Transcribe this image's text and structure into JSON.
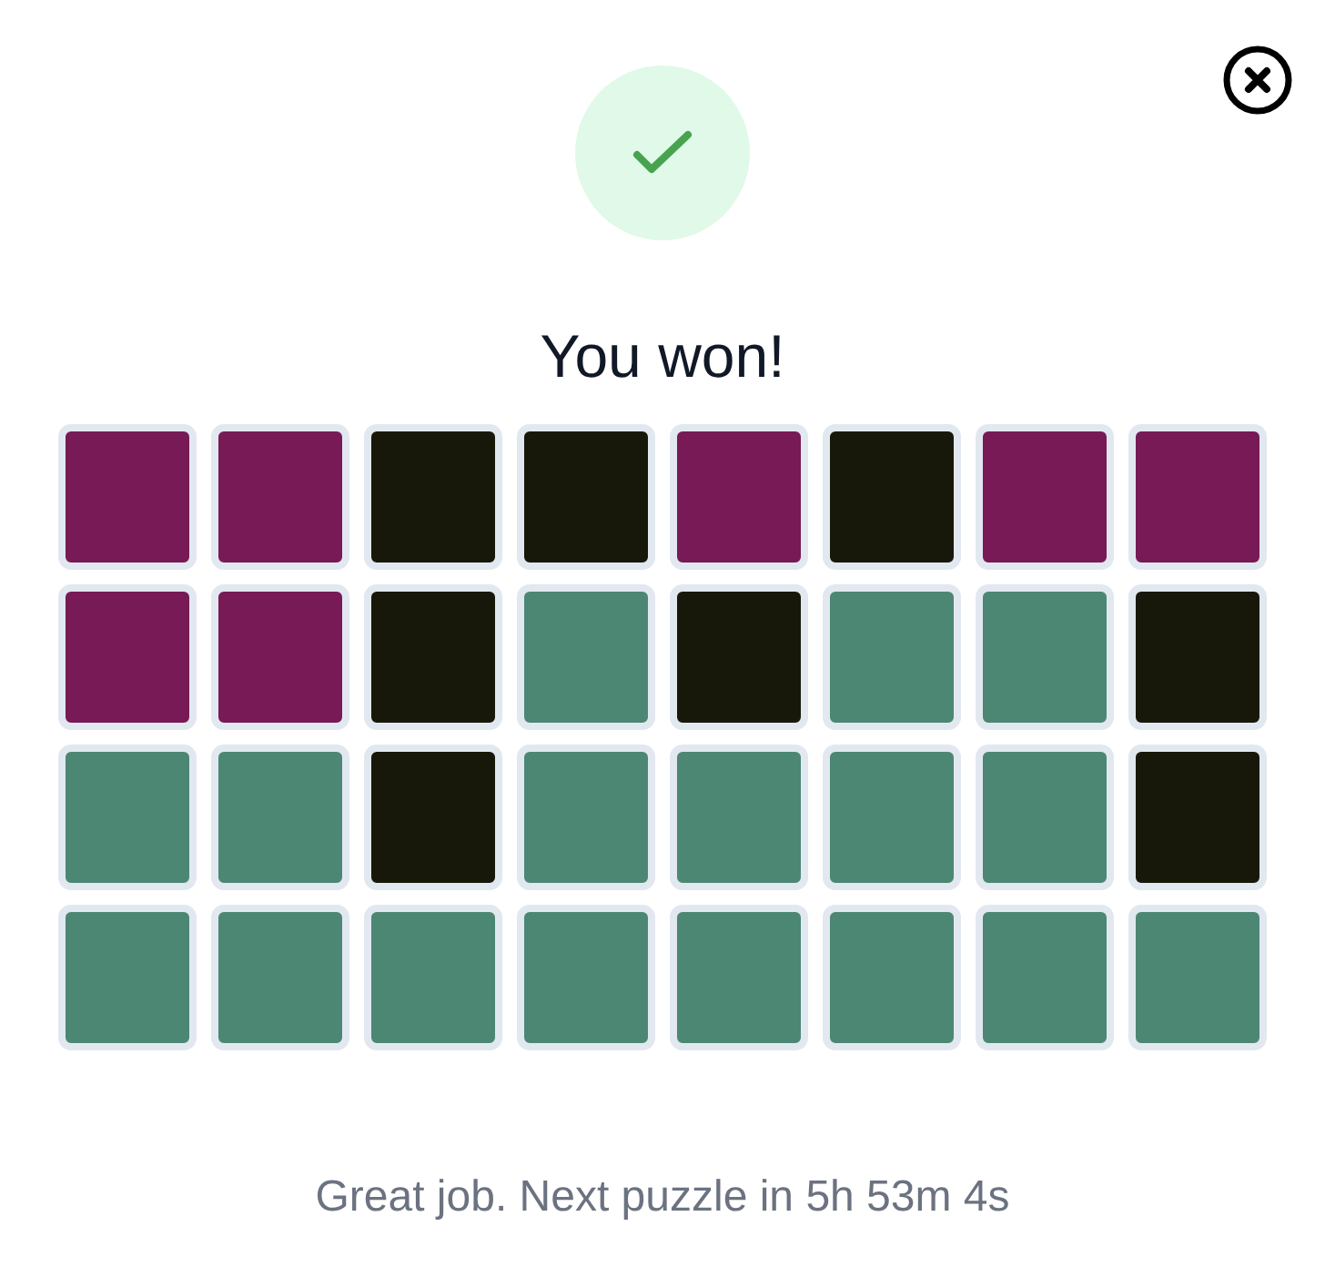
{
  "result": {
    "success": true,
    "title": "You won!"
  },
  "grid": [
    [
      {
        "color": "#771a55"
      },
      {
        "color": "#771a55"
      },
      {
        "color": "#18180a"
      },
      {
        "color": "#18180a"
      },
      {
        "color": "#771a55"
      },
      {
        "color": "#18180a"
      },
      {
        "color": "#771a55"
      },
      {
        "color": "#771a55"
      }
    ],
    [
      {
        "color": "#771a55"
      },
      {
        "color": "#771a55"
      },
      {
        "color": "#18180a"
      },
      {
        "color": "#4c8774"
      },
      {
        "color": "#18180a"
      },
      {
        "color": "#4c8774"
      },
      {
        "color": "#4c8774"
      },
      {
        "color": "#18180a"
      }
    ],
    [
      {
        "color": "#4c8774"
      },
      {
        "color": "#4c8774"
      },
      {
        "color": "#18180a"
      },
      {
        "color": "#4c8774"
      },
      {
        "color": "#4c8774"
      },
      {
        "color": "#4c8774"
      },
      {
        "color": "#4c8774"
      },
      {
        "color": "#18180a"
      }
    ],
    [
      {
        "color": "#4c8774"
      },
      {
        "color": "#4c8774"
      },
      {
        "color": "#4c8774"
      },
      {
        "color": "#4c8774"
      },
      {
        "color": "#4c8774"
      },
      {
        "color": "#4c8774"
      },
      {
        "color": "#4c8774"
      },
      {
        "color": "#4c8774"
      }
    ]
  ],
  "footer": "Great job. Next puzzle in 5h 53m 4s"
}
